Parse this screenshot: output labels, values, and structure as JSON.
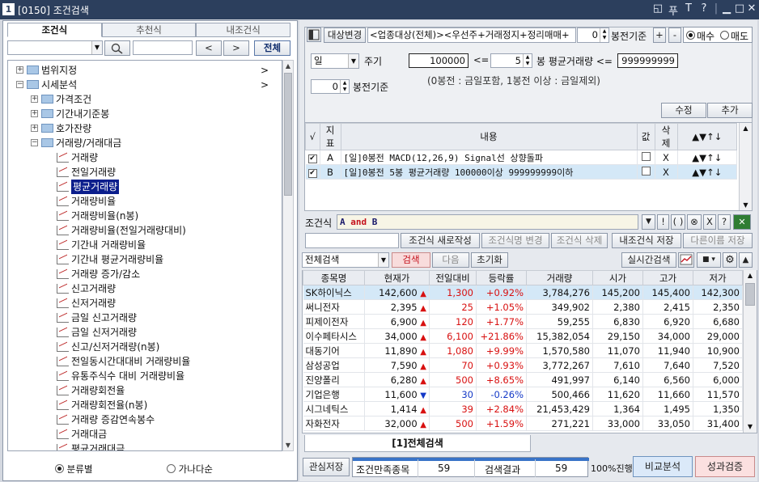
{
  "window": {
    "num": "1",
    "title": "[0150] 조건검색",
    "controls": [
      "◱",
      "푸",
      "T",
      "?",
      "|",
      "▁",
      "□",
      "✕"
    ]
  },
  "left": {
    "tabs": [
      "조건식",
      "추천식",
      "내조건식"
    ],
    "nav": {
      "prev": "<",
      "next": ">",
      "all": "전체"
    },
    "tree": [
      {
        "label": "범위지정",
        "level": 0,
        "type": "folder",
        "arrow": ">"
      },
      {
        "label": "시세분석",
        "level": 0,
        "type": "folder",
        "arrow": ">",
        "open": true
      },
      {
        "label": "가격조건",
        "level": 1,
        "type": "folder"
      },
      {
        "label": "기간내기준봉",
        "level": 1,
        "type": "folder"
      },
      {
        "label": "호가잔량",
        "level": 1,
        "type": "folder"
      },
      {
        "label": "거래량/거래대금",
        "level": 1,
        "type": "folder",
        "open": true
      },
      {
        "label": "거래량",
        "level": 2,
        "type": "item"
      },
      {
        "label": "전일거래량",
        "level": 2,
        "type": "item"
      },
      {
        "label": "평균거래량",
        "level": 2,
        "type": "item",
        "selected": true
      },
      {
        "label": "거래량비율",
        "level": 2,
        "type": "item"
      },
      {
        "label": "거래량비율(n봉)",
        "level": 2,
        "type": "item"
      },
      {
        "label": "거래량비율(전일거래량대비)",
        "level": 2,
        "type": "item"
      },
      {
        "label": "기간내 거래량비율",
        "level": 2,
        "type": "item"
      },
      {
        "label": "기간내 평균거래량비율",
        "level": 2,
        "type": "item"
      },
      {
        "label": "거래량 증가/감소",
        "level": 2,
        "type": "item"
      },
      {
        "label": "신고거래량",
        "level": 2,
        "type": "item"
      },
      {
        "label": "신저거래량",
        "level": 2,
        "type": "item"
      },
      {
        "label": "금일 신고거래량",
        "level": 2,
        "type": "item"
      },
      {
        "label": "금일 신저거래량",
        "level": 2,
        "type": "item"
      },
      {
        "label": "신고/신저거래량(n봉)",
        "level": 2,
        "type": "item"
      },
      {
        "label": "전일동시간대대비 거래량비율",
        "level": 2,
        "type": "item"
      },
      {
        "label": "유통주식수 대비 거래량비율",
        "level": 2,
        "type": "item"
      },
      {
        "label": "거래량회전율",
        "level": 2,
        "type": "item"
      },
      {
        "label": "거래량회전율(n봉)",
        "level": 2,
        "type": "item"
      },
      {
        "label": "거래량 증감연속봉수",
        "level": 2,
        "type": "item"
      },
      {
        "label": "거래대금",
        "level": 2,
        "type": "item"
      },
      {
        "label": "평균거래대금",
        "level": 2,
        "type": "item"
      }
    ],
    "radios": [
      {
        "label": "분류별",
        "checked": true
      },
      {
        "label": "가나다순",
        "checked": false
      }
    ]
  },
  "right": {
    "target_btn": "대상변경",
    "target_text": "<업종대상(전체)><우선주+거래정지+정리매매+",
    "offset": "0",
    "offset_label": "봉전기준",
    "plus": "+",
    "minus": "-",
    "buy": "매수",
    "sell": "매도",
    "period": "일",
    "period_label": "주기",
    "vol_min": "100000",
    "lte": "<=",
    "bars": "5",
    "bars_label": "봉 평균거래량 <=",
    "vol_max": "999999999",
    "bar_offset": "0",
    "bar_offset_label": "봉전기준",
    "note": "(0봉전 : 금일포함, 1봉전 이상 : 금일제외)",
    "edit": "수정",
    "add": "추가",
    "cond_headers": [
      "√",
      "지표",
      "내용",
      "값",
      "삭제",
      "▲▼↑↓"
    ],
    "conditions": [
      {
        "checked": true,
        "id": "A",
        "text": "[일]0봉전 MACD(12,26,9) Signal선 상향돌파",
        "del": "X",
        "moves": "▲▼↑↓"
      },
      {
        "checked": true,
        "id": "B",
        "text": "[일]0봉전 5봉 평균거래량 100000이상 999999999이하",
        "del": "X",
        "moves": "▲▼↑↓"
      }
    ],
    "formula_label": "조건식",
    "formula_a": "A",
    "formula_and": "and",
    "formula_b": "B",
    "formula_btns": [
      "▼",
      "!",
      "( )",
      "⊗",
      "X",
      "?"
    ],
    "action_btns": [
      "조건식 새로작성",
      "조건식명 변경",
      "조건식 삭제",
      "내조건식 저장",
      "다른이름 저장"
    ],
    "search_select": "전체검색",
    "search_btn": "검색",
    "next_btn": "다음",
    "reset_btn": "초기화",
    "realtime_btn": "실시간검색",
    "result_headers": [
      "종목명",
      "현재가",
      "전일대비",
      "등락률",
      "거래량",
      "시가",
      "고가",
      "저가"
    ],
    "results": [
      {
        "name": "SK하이닉스",
        "price": "142,600",
        "dir": "up",
        "chg": "1,300",
        "pct": "+0.92%",
        "vol": "3,784,276",
        "open": "145,200",
        "high": "145,400",
        "low": "142,300"
      },
      {
        "name": "써니전자",
        "price": "2,395",
        "dir": "up",
        "chg": "25",
        "pct": "+1.05%",
        "vol": "349,902",
        "open": "2,380",
        "high": "2,415",
        "low": "2,350"
      },
      {
        "name": "피제이전자",
        "price": "6,900",
        "dir": "up",
        "chg": "120",
        "pct": "+1.77%",
        "vol": "59,255",
        "open": "6,830",
        "high": "6,920",
        "low": "6,680"
      },
      {
        "name": "이수페타시스",
        "price": "34,000",
        "dir": "up",
        "chg": "6,100",
        "pct": "+21.86%",
        "vol": "15,382,054",
        "open": "29,150",
        "high": "34,000",
        "low": "29,000"
      },
      {
        "name": "대동기어",
        "price": "11,890",
        "dir": "up",
        "chg": "1,080",
        "pct": "+9.99%",
        "vol": "1,570,580",
        "open": "11,070",
        "high": "11,940",
        "low": "10,900"
      },
      {
        "name": "삼성공업",
        "price": "7,590",
        "dir": "up",
        "chg": "70",
        "pct": "+0.93%",
        "vol": "3,772,267",
        "open": "7,610",
        "high": "7,640",
        "low": "7,520"
      },
      {
        "name": "진양폴리",
        "price": "6,280",
        "dir": "up",
        "chg": "500",
        "pct": "+8.65%",
        "vol": "491,997",
        "open": "6,140",
        "high": "6,560",
        "low": "6,000"
      },
      {
        "name": "기업은행",
        "price": "11,600",
        "dir": "down",
        "chg": "30",
        "pct": "-0.26%",
        "vol": "500,466",
        "open": "11,620",
        "high": "11,660",
        "low": "11,570"
      },
      {
        "name": "시그네틱스",
        "price": "1,414",
        "dir": "up",
        "chg": "39",
        "pct": "+2.84%",
        "vol": "21,453,429",
        "open": "1,364",
        "high": "1,495",
        "low": "1,350"
      },
      {
        "name": "자화전자",
        "price": "32,000",
        "dir": "up",
        "chg": "500",
        "pct": "+1.59%",
        "vol": "271,221",
        "open": "33,000",
        "high": "33,050",
        "low": "31,400"
      }
    ],
    "result_tab": "[1]전체검색",
    "bottom": {
      "save": "관심저장",
      "matched_label": "조건만족종목",
      "matched": "59",
      "result_label": "검색결과",
      "result": "59",
      "progress": "100%진행",
      "progress_value": 1.0,
      "compare": "비교분석",
      "verify": "성과검증"
    }
  },
  "colors": {
    "title": "#2c3f5d",
    "up": "#d81010",
    "down": "#1439c7",
    "selected": "#0b1e8c",
    "highlight_row": "#d4e8f7"
  }
}
